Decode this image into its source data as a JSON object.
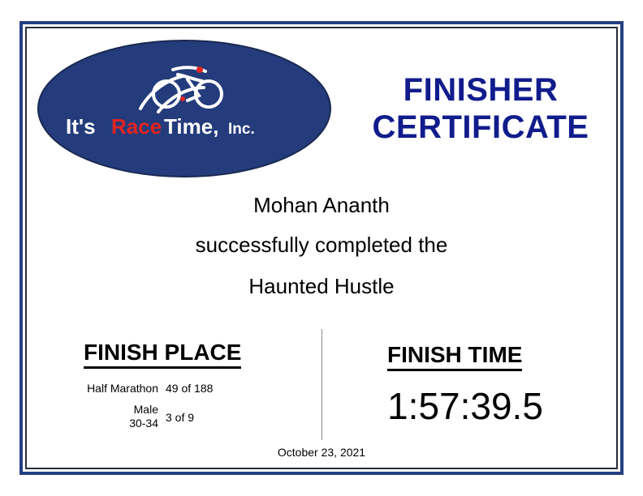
{
  "logo": {
    "brand_part1": "It's",
    "brand_part2": "Race",
    "brand_part3": "Time,",
    "brand_part4": "Inc.",
    "icon": "cyclist-runner-swimmer-icon",
    "colors": {
      "oval": "#243c7c",
      "accent": "#e32420",
      "text": "#ffffff"
    }
  },
  "certificate": {
    "title_line1": "FINISHER",
    "title_line2": "CERTIFICATE",
    "title_color": "#111c8c"
  },
  "recipient": {
    "name": "Mohan Ananth",
    "phrase": "successfully completed the",
    "event": "Haunted Hustle"
  },
  "finish_place": {
    "heading": "FINISH PLACE",
    "rows": [
      {
        "label": "Half Marathon",
        "value": "49 of 188"
      },
      {
        "label_line1": "Male",
        "label_line2": "30-34",
        "value": "3 of 9"
      }
    ]
  },
  "finish_time": {
    "heading": "FINISH TIME",
    "value": "1:57:39.5"
  },
  "date": "October 23, 2021"
}
